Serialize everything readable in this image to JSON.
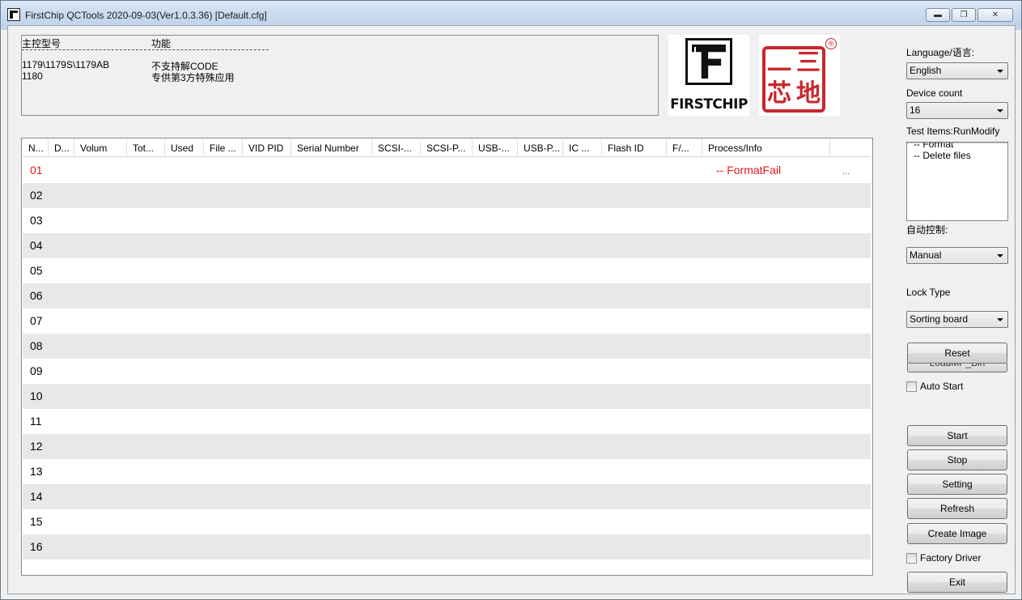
{
  "window": {
    "title": "FirstChip QCTools 2020-09-03(Ver1.0.3.36) [Default.cfg]"
  },
  "info": {
    "header_model": "主控型号",
    "header_function": "功能",
    "rows": [
      {
        "model": "1179\\1179S\\1179AB",
        "function": "不支持解CODE"
      },
      {
        "model": "1180",
        "function": "专供第3方特殊应用"
      }
    ]
  },
  "logos": {
    "brand1": "FIRSTCHIP",
    "brand1_icon": "firstchip-logo",
    "brand2_chars": [
      "三",
      "地",
      "一",
      "芯"
    ],
    "brand2_reg": "®"
  },
  "grid": {
    "columns": [
      {
        "label": "N..."
      },
      {
        "label": "D..."
      },
      {
        "label": "Volum"
      },
      {
        "label": "Tot..."
      },
      {
        "label": "Used"
      },
      {
        "label": "File ..."
      },
      {
        "label": "VID PID"
      },
      {
        "label": "Serial Number"
      },
      {
        "label": "SCSI-..."
      },
      {
        "label": "SCSI-P..."
      },
      {
        "label": "USB-..."
      },
      {
        "label": "USB-P..."
      },
      {
        "label": "IC ..."
      },
      {
        "label": "Flash ID"
      },
      {
        "label": "F/..."
      },
      {
        "label": "Process/Info"
      }
    ],
    "rows": [
      {
        "no": "01",
        "process": "-- FormatFail",
        "extra": "...",
        "fail": true
      },
      {
        "no": "02",
        "process": "",
        "extra": ""
      },
      {
        "no": "03",
        "process": "",
        "extra": ""
      },
      {
        "no": "04",
        "process": "",
        "extra": ""
      },
      {
        "no": "05",
        "process": "",
        "extra": ""
      },
      {
        "no": "06",
        "process": "",
        "extra": ""
      },
      {
        "no": "07",
        "process": "",
        "extra": ""
      },
      {
        "no": "08",
        "process": "",
        "extra": ""
      },
      {
        "no": "09",
        "process": "",
        "extra": ""
      },
      {
        "no": "10",
        "process": "",
        "extra": ""
      },
      {
        "no": "11",
        "process": "",
        "extra": ""
      },
      {
        "no": "12",
        "process": "",
        "extra": ""
      },
      {
        "no": "13",
        "process": "",
        "extra": ""
      },
      {
        "no": "14",
        "process": "",
        "extra": ""
      },
      {
        "no": "15",
        "process": "",
        "extra": ""
      },
      {
        "no": "16",
        "process": "",
        "extra": ""
      }
    ]
  },
  "side": {
    "language_label": "Language/语言:",
    "language_value": "English",
    "device_count_label": "Device count",
    "device_count_value": "16",
    "test_items_label": "Test Items:RunModify",
    "test_items": [
      "-- Format",
      "-- Delete files"
    ],
    "auto_control_label": "自动控制:",
    "auto_control_value": "Manual",
    "lock_type_label": "Lock Type",
    "lock_type_value": "Sorting board",
    "reset_label": "Reset",
    "loadmp_label": "LoadMP_Bin",
    "auto_start_label": "Auto Start",
    "start_label": "Start",
    "stop_label": "Stop",
    "setting_label": "Setting",
    "refresh_label": "Refresh",
    "create_image_label": "Create Image",
    "factory_driver_label": "Factory Driver",
    "exit_label": "Exit"
  },
  "colors": {
    "fail_red": "#e4161f",
    "seal_red": "#c8272d",
    "row_alt": "#e8e8e8"
  }
}
